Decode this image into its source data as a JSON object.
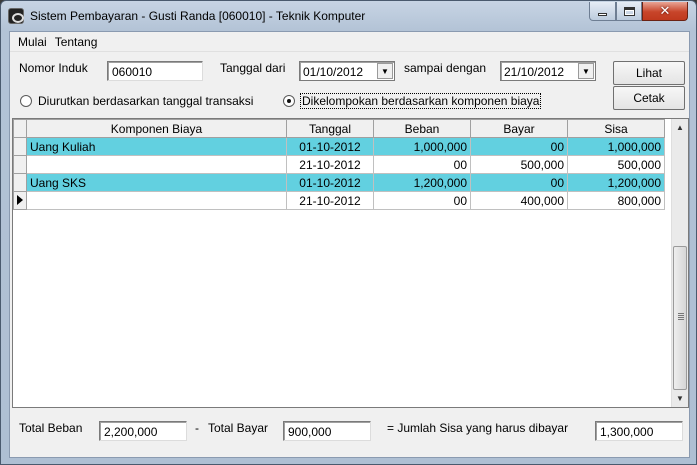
{
  "window": {
    "title": "Sistem Pembayaran - Gusti Randa [060010] - Teknik Komputer",
    "close_glyph": "✕"
  },
  "menu": [
    "Mulai",
    "Tentang"
  ],
  "filter": {
    "nomor_induk_label": "Nomor Induk",
    "nomor_induk_value": "060010",
    "tanggal_dari_label": "Tanggal dari",
    "tanggal_dari_value": "01/10/2012",
    "sampai_label": "sampai dengan",
    "sampai_value": "21/10/2012"
  },
  "buttons": {
    "lihat": "Lihat",
    "cetak": "Cetak"
  },
  "options": {
    "by_date": "Diurutkan berdasarkan tanggal transaksi",
    "by_component": "Dikelompokan berdasarkan komponen biaya",
    "selected": "by_component"
  },
  "table": {
    "columns": [
      "Komponen Biaya",
      "Tanggal",
      "Beban",
      "Bayar",
      "Sisa"
    ],
    "rows": [
      {
        "komponen": "Uang Kuliah",
        "tanggal": "01-10-2012",
        "beban": "1,000,000",
        "bayar": "00",
        "sisa": "1,000,000",
        "highlight": true
      },
      {
        "komponen": "",
        "tanggal": "21-10-2012",
        "beban": "00",
        "bayar": "500,000",
        "sisa": "500,000",
        "highlight": false
      },
      {
        "komponen": "Uang SKS",
        "tanggal": "01-10-2012",
        "beban": "1,200,000",
        "bayar": "00",
        "sisa": "1,200,000",
        "highlight": true
      },
      {
        "komponen": "",
        "tanggal": "21-10-2012",
        "beban": "00",
        "bayar": "400,000",
        "sisa": "800,000",
        "highlight": false,
        "current": true
      }
    ],
    "highlight_color": "#62d0e0"
  },
  "totals": {
    "total_beban_label": "Total Beban",
    "total_beban_value": "2,200,000",
    "minus": "-",
    "total_bayar_label": "Total Bayar",
    "total_bayar_value": "900,000",
    "jumlah_sisa_label": "= Jumlah Sisa yang harus dibayar",
    "jumlah_sisa_value": "1,300,000"
  }
}
